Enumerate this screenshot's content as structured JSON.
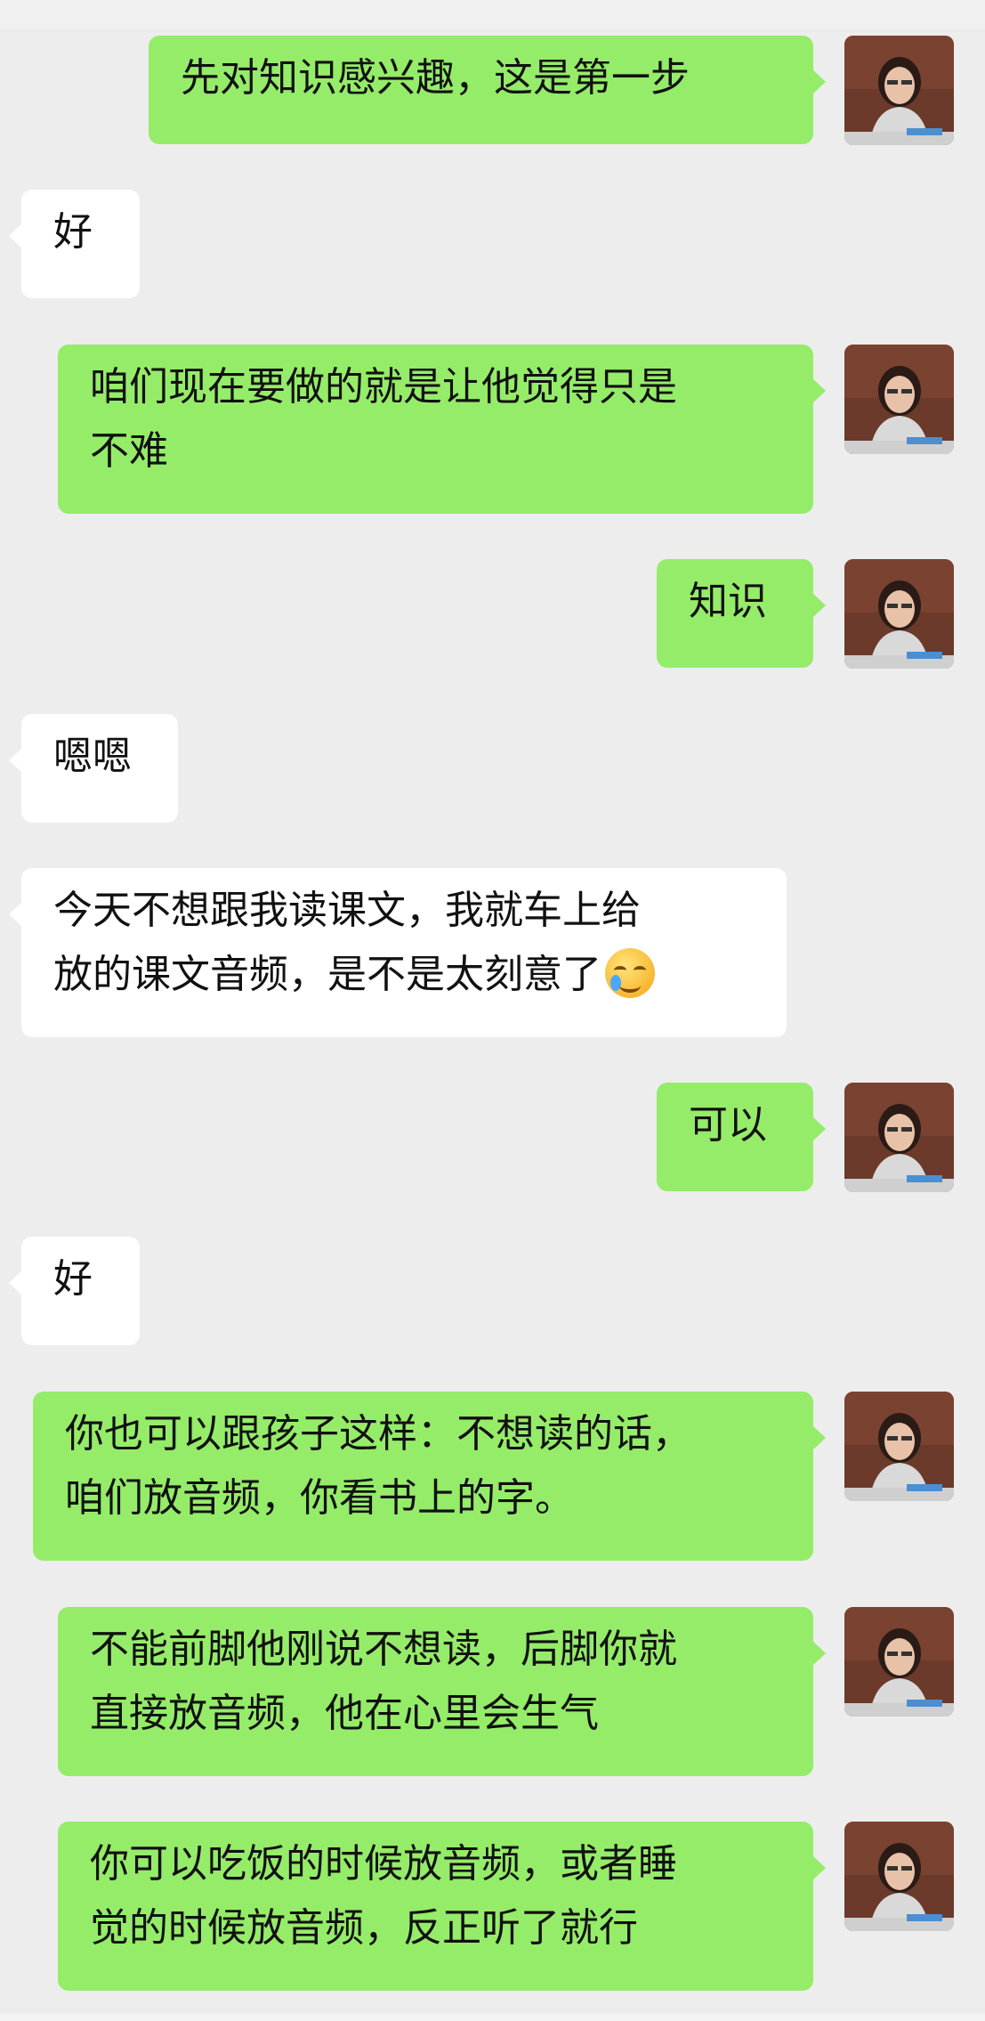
{
  "messages": [
    {
      "side": "out",
      "text": "先对知识感兴趣，这是第一步"
    },
    {
      "side": "in",
      "text": "好"
    },
    {
      "side": "out",
      "lines": [
        "咱们现在要做的就是让他觉得只是",
        "不难"
      ]
    },
    {
      "side": "out",
      "text": "知识"
    },
    {
      "side": "in",
      "text": "嗯嗯"
    },
    {
      "side": "in",
      "lines": [
        "今天不想跟我读课文，我就车上给",
        "放的课文音频，是不是太刻意了"
      ],
      "emoji": "crying-laughing-face-icon"
    },
    {
      "side": "out",
      "text": "可以"
    },
    {
      "side": "in",
      "text": "好"
    },
    {
      "side": "out",
      "lines": [
        "你也可以跟孩子这样：不想读的话，",
        "咱们放音频，你看书上的字。"
      ]
    },
    {
      "side": "out",
      "lines": [
        "不能前脚他刚说不想读，后脚你就",
        "直接放音频，他在心里会生气"
      ]
    },
    {
      "side": "out",
      "lines": [
        "你可以吃饭的时候放音频，或者睡",
        "觉的时候放音频，反正听了就行"
      ]
    }
  ],
  "colors": {
    "background": "#ededed",
    "outgoing_bubble": "#95ec69",
    "incoming_bubble": "#ffffff"
  }
}
